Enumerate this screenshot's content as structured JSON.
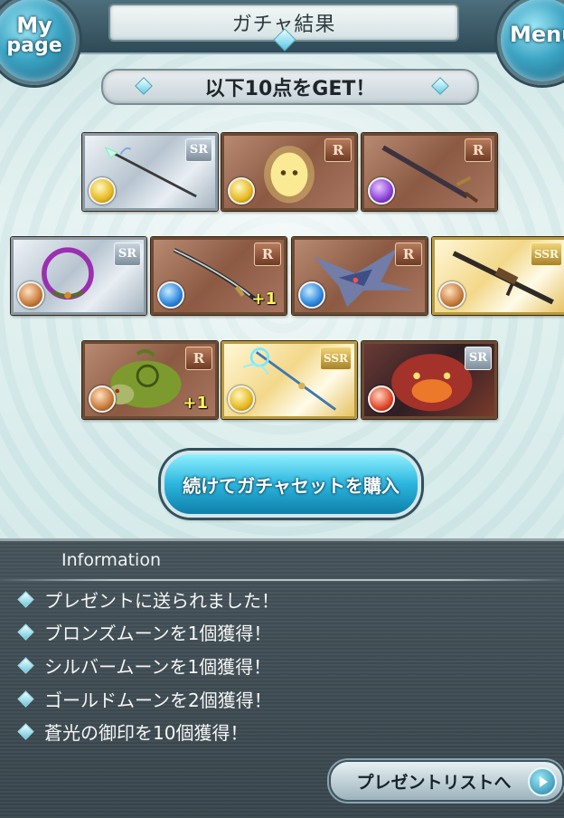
{
  "header": {
    "mypage_line1": "My",
    "mypage_line2": "page",
    "title": "ガチャ結果",
    "menu_label": "Menu"
  },
  "banner": {
    "text": "以下10点をGET！"
  },
  "cards": [
    {
      "rarity": "SR",
      "element": "light",
      "kind": "spear",
      "bg": "sr",
      "bonus": ""
    },
    {
      "rarity": "R",
      "element": "light",
      "kind": "spirit",
      "bg": "r",
      "bonus": ""
    },
    {
      "rarity": "R",
      "element": "dark",
      "kind": "sword",
      "bg": "r",
      "bonus": ""
    },
    {
      "rarity": "SR",
      "element": "earth",
      "kind": "ring",
      "bg": "sr",
      "bonus": ""
    },
    {
      "rarity": "R",
      "element": "water",
      "kind": "katana",
      "bg": "r",
      "bonus": "+1"
    },
    {
      "rarity": "R",
      "element": "water",
      "kind": "dragon",
      "bg": "r",
      "bonus": ""
    },
    {
      "rarity": "SSR",
      "element": "earth",
      "kind": "gun",
      "bg": "ssr",
      "bonus": ""
    },
    {
      "rarity": "R",
      "element": "earth",
      "kind": "turtle",
      "bg": "r",
      "bonus": "+1"
    },
    {
      "rarity": "SSR",
      "element": "light",
      "kind": "staff",
      "bg": "ssr",
      "bonus": ""
    },
    {
      "rarity": "SR",
      "element": "fire",
      "kind": "beast",
      "bg": "dark",
      "bonus": ""
    }
  ],
  "buy_button": {
    "label": "続けてガチャセットを購入"
  },
  "info": {
    "heading": "Information",
    "messages": [
      "プレゼントに送られました！",
      "ブロンズムーンを1個獲得！",
      "シルバームーンを1個獲得！",
      "ゴールドムーンを2個獲得！",
      "蒼光の御印を10個獲得！"
    ],
    "present_button": "プレゼントリストへ"
  }
}
